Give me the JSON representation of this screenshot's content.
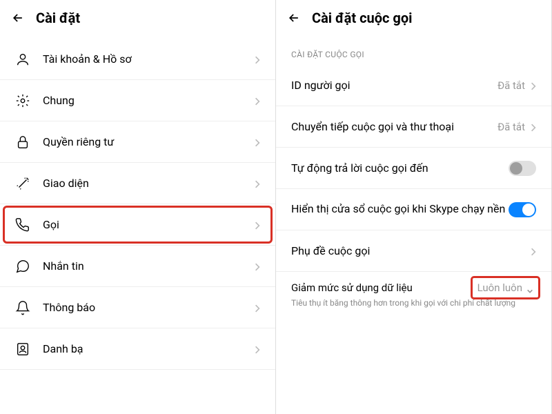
{
  "left": {
    "title": "Cài đặt",
    "items": [
      {
        "icon": "user",
        "label": "Tài khoản & Hồ sơ"
      },
      {
        "icon": "gear",
        "label": "Chung"
      },
      {
        "icon": "lock",
        "label": "Quyền riêng tư"
      },
      {
        "icon": "wand",
        "label": "Giao diện"
      },
      {
        "icon": "phone",
        "label": "Gọi",
        "highlight": true
      },
      {
        "icon": "chat",
        "label": "Nhắn tin"
      },
      {
        "icon": "bell",
        "label": "Thông báo"
      },
      {
        "icon": "contacts",
        "label": "Danh bạ"
      }
    ]
  },
  "right": {
    "title": "Cài đặt cuộc gọi",
    "section": "CÀI ĐẶT CUỘC GỌI",
    "callerId": {
      "label": "ID người gọi",
      "value": "Đã tắt"
    },
    "forward": {
      "label": "Chuyển tiếp cuộc gọi và thư thoại",
      "value": "Đã tắt"
    },
    "autoAnswer": {
      "label": "Tự động trả lời cuộc gọi đến",
      "on": false
    },
    "showWindow": {
      "label": "Hiển thị cửa sổ cuộc gọi khi Skype chạy nền",
      "on": true
    },
    "subtitles": {
      "label": "Phụ đề cuộc gọi"
    },
    "dataUsage": {
      "label": "Giảm mức sử dụng dữ liệu",
      "value": "Luôn luôn",
      "desc": "Tiêu thụ ít băng thông hơn trong khi gọi với chi phí chất lượng",
      "highlight": true
    }
  }
}
